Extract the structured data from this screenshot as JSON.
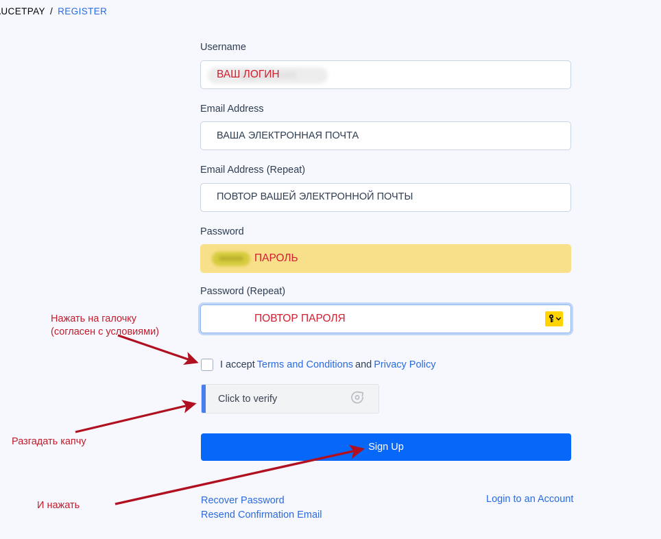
{
  "breadcrumb": {
    "root": "AUCETPAY",
    "separator": "/",
    "current": "REGISTER"
  },
  "form": {
    "fields": [
      {
        "label": "Username",
        "value": "ВАШ ЛОГИН",
        "redacted_underlay": "@gmail.com",
        "state": "normal"
      },
      {
        "label": "Email Address",
        "value": "ВАША ЭЛЕКТРОННАЯ ПОЧТА",
        "state": "normal"
      },
      {
        "label": "Email Address (Repeat)",
        "value": "ПОВТОР ВАШЕЙ ЭЛЕКТРОННОЙ ПОЧТЫ",
        "state": "normal"
      },
      {
        "label": "Password",
        "value": "ПАРОЛЬ",
        "state": "autofilled"
      },
      {
        "label": "Password (Repeat)",
        "value": "ПОВТОР ПАРОЛЯ",
        "state": "focused"
      }
    ]
  },
  "terms": {
    "accept_text": "I accept",
    "terms_link": "Terms and Conditions",
    "and_text": "and",
    "privacy_link": "Privacy Policy",
    "checked": false
  },
  "captcha": {
    "label": "Click to verify",
    "icon": "refresh-circle-icon"
  },
  "submit": {
    "label": "Sign Up"
  },
  "footer": {
    "recover_password": "Recover Password",
    "resend_confirmation": "Resend Confirmation Email",
    "login_account": "Login to an Account"
  },
  "annotations": [
    {
      "id": "terms",
      "line1": "Нажать на галочку",
      "line2": "(согласен с условиями)"
    },
    {
      "id": "captcha",
      "line1": "Разгадать капчу"
    },
    {
      "id": "press",
      "line1": "И нажать"
    }
  ],
  "colors": {
    "page_background": "#f6f8fd",
    "link": "#2a6ae0",
    "primary_button": "#0667f9",
    "annotation_red": "#c21b2b",
    "input_red_text": "#d02030",
    "autofill_yellow": "#f8e08b",
    "key_badge_yellow": "#ffd400",
    "captcha_accent": "#4a7df0"
  }
}
